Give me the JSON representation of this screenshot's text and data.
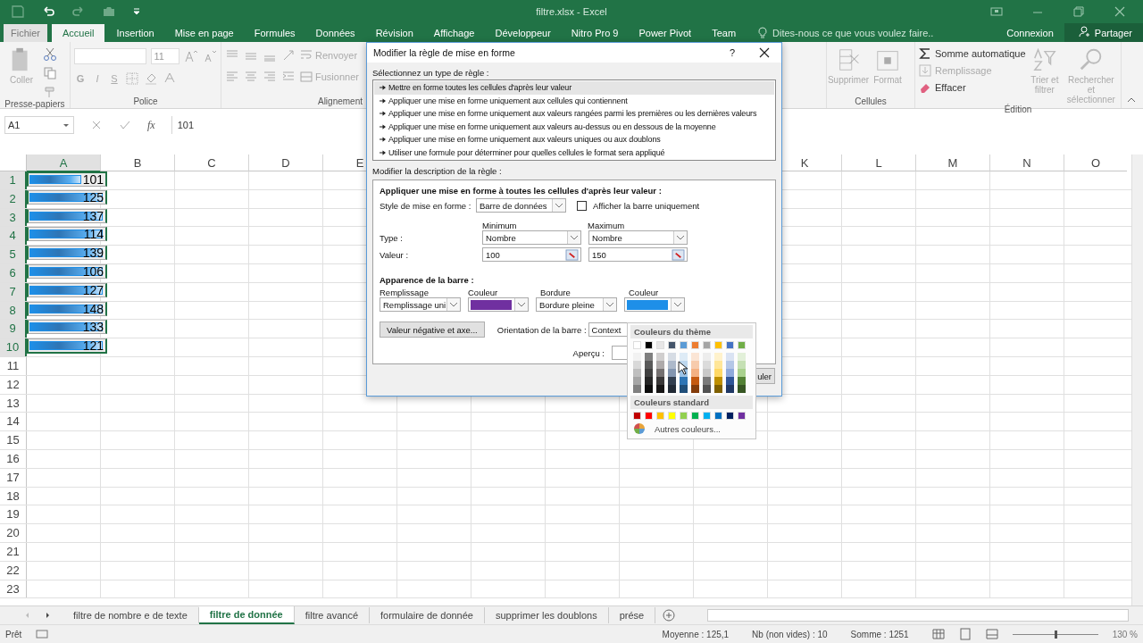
{
  "title_bar": {
    "title": "filtre.xlsx - Excel"
  },
  "ribbon_tabs": [
    {
      "label": "Fichier",
      "selected": false,
      "kind": "file"
    },
    {
      "label": "Accueil",
      "selected": true,
      "kind": "tab"
    },
    {
      "label": "Insertion",
      "selected": false,
      "kind": "tab"
    },
    {
      "label": "Mise en page",
      "selected": false,
      "kind": "tab"
    },
    {
      "label": "Formules",
      "selected": false,
      "kind": "tab"
    },
    {
      "label": "Données",
      "selected": false,
      "kind": "tab"
    },
    {
      "label": "Révision",
      "selected": false,
      "kind": "tab"
    },
    {
      "label": "Affichage",
      "selected": false,
      "kind": "tab"
    },
    {
      "label": "Développeur",
      "selected": false,
      "kind": "tab"
    },
    {
      "label": "Nitro Pro 9",
      "selected": false,
      "kind": "tab"
    },
    {
      "label": "Power Pivot",
      "selected": false,
      "kind": "tab"
    },
    {
      "label": "Team",
      "selected": false,
      "kind": "tab"
    }
  ],
  "tell_me": {
    "placeholder": "Dites-nous ce que vous voulez faire.."
  },
  "account": {
    "sign_in": "Connexion",
    "share": "Partager"
  },
  "ribbon": {
    "clipboard": {
      "paste": "Coller",
      "group": "Presse-papiers"
    },
    "font": {
      "size": "11",
      "bold": "G",
      "italic": "I",
      "underline": "S",
      "group": "Police"
    },
    "alignment": {
      "wrap": "Renvoyer",
      "merge": "Fusionner",
      "group": "Alignement"
    },
    "cells": {
      "delete": "Supprimer",
      "format": "Format",
      "group": "Cellules"
    },
    "editing": {
      "autosum": "Somme automatique",
      "fill": "Remplissage",
      "clear": "Effacer",
      "sort_filter": "Trier et filtrer",
      "find_select": "Rechercher et sélectionner",
      "group": "Édition"
    }
  },
  "formula_bar": {
    "name_box": "A1",
    "function_label": "fx",
    "formula": "101"
  },
  "sheet": {
    "columns_left": [
      "A",
      "B",
      "C",
      "D",
      "E"
    ],
    "columns_right": [
      "K",
      "L",
      "M",
      "N",
      "O"
    ],
    "row_numbers": [
      "1",
      "2",
      "3",
      "4",
      "5",
      "6",
      "7",
      "8",
      "9",
      "10",
      "11",
      "12",
      "13",
      "14",
      "15",
      "16",
      "17",
      "18",
      "19",
      "20",
      "21",
      "22",
      "23"
    ],
    "cells": [
      {
        "value": "101",
        "level": 0.67,
        "selected": true
      },
      {
        "value": "125",
        "level": 0.95,
        "selected": true
      },
      {
        "value": "137",
        "level": 0.95,
        "selected": true
      },
      {
        "value": "114",
        "level": 0.95,
        "selected": true
      },
      {
        "value": "139",
        "level": 0.95,
        "selected": true
      },
      {
        "value": "106",
        "level": 0.95,
        "selected": true
      },
      {
        "value": "127",
        "level": 0.95,
        "selected": true
      },
      {
        "value": "148",
        "level": 0.95,
        "selected": true
      },
      {
        "value": "133",
        "level": 0.95,
        "selected": true
      },
      {
        "value": "121",
        "level": 0.95,
        "selected": true
      }
    ]
  },
  "dialog": {
    "title": "Modifier la règle de mise en forme",
    "help": "?",
    "rule_type_label": "Sélectionnez un type de règle :",
    "rule_types": [
      {
        "label": "Mettre en forme toutes les cellules d'après leur valeur",
        "selected": true
      },
      {
        "label": "Appliquer une mise en forme uniquement aux cellules qui contiennent",
        "selected": false
      },
      {
        "label": "Appliquer une mise en forme uniquement aux valeurs rangées parmi les premières ou les dernières valeurs",
        "selected": false
      },
      {
        "label": "Appliquer une mise en forme uniquement aux valeurs au-dessus ou en dessous de la moyenne",
        "selected": false
      },
      {
        "label": "Appliquer une mise en forme uniquement aux valeurs uniques ou aux doublons",
        "selected": false
      },
      {
        "label": "Utiliser une formule pour déterminer pour quelles cellules le format sera appliqué",
        "selected": false
      }
    ],
    "description_label": "Modifier la description de la règle :",
    "description_heading": "Appliquer une mise en forme à toutes les cellules d'après leur valeur :",
    "style_label": "Style de mise en forme :",
    "style_value": "Barre de données",
    "bar_only": {
      "label": "Afficher la barre uniquement",
      "checked": false
    },
    "minimum_heading": "Minimum",
    "maximum_heading": "Maximum",
    "type_label": "Type :",
    "min_type": "Nombre",
    "max_type": "Nombre",
    "value_label": "Valeur :",
    "min_value": "100",
    "max_value": "150",
    "appearance_heading": "Apparence de la barre :",
    "fill_label": "Remplissage",
    "fill_value": "Remplissage uni",
    "fill_color_label": "Couleur",
    "fill_color": {
      "color": "#7030a0"
    },
    "border_label": "Bordure",
    "border_value": "Bordure pleine",
    "border_color_label": "Couleur",
    "border_color": {
      "color": "#1e8fe8"
    },
    "negative_button": "Valeur négative et axe...",
    "orientation_label": "Orientation de la barre :",
    "orientation_value": "Context",
    "preview_label": "Aperçu :",
    "cancel_button": "uler"
  },
  "color_menu": {
    "theme_heading": "Couleurs du thème",
    "theme_columns": [
      {
        "color": "#ffffff",
        "shades": [
          {
            "color": "#f2f2f2"
          },
          {
            "color": "#d9d9d9"
          },
          {
            "color": "#bfbfbf"
          },
          {
            "color": "#a6a6a6"
          },
          {
            "color": "#808080"
          }
        ]
      },
      {
        "color": "#000000",
        "shades": [
          {
            "color": "#7f7f7f"
          },
          {
            "color": "#595959"
          },
          {
            "color": "#404040"
          },
          {
            "color": "#262626"
          },
          {
            "color": "#0d0d0d"
          }
        ]
      },
      {
        "color": "#e7e6e6",
        "shades": [
          {
            "color": "#d0cece"
          },
          {
            "color": "#aeaaaa"
          },
          {
            "color": "#757171"
          },
          {
            "color": "#3a3838"
          },
          {
            "color": "#171616"
          }
        ]
      },
      {
        "color": "#44546a",
        "shades": [
          {
            "color": "#d6dce4"
          },
          {
            "color": "#adb9ca"
          },
          {
            "color": "#8496b0"
          },
          {
            "color": "#333f4f"
          },
          {
            "color": "#222a35"
          }
        ]
      },
      {
        "color": "#5b9bd5",
        "shades": [
          {
            "color": "#deebf6"
          },
          {
            "color": "#bdd7ee"
          },
          {
            "color": "#9dc3e6"
          },
          {
            "color": "#2e75b5"
          },
          {
            "color": "#1f4e79"
          }
        ]
      },
      {
        "color": "#ed7d31",
        "shades": [
          {
            "color": "#fbe5d5"
          },
          {
            "color": "#f7cbac"
          },
          {
            "color": "#f4b183"
          },
          {
            "color": "#c55a11"
          },
          {
            "color": "#843c0b"
          }
        ]
      },
      {
        "color": "#a5a5a5",
        "shades": [
          {
            "color": "#ededed"
          },
          {
            "color": "#dbdbdb"
          },
          {
            "color": "#c9c9c9"
          },
          {
            "color": "#7b7b7b"
          },
          {
            "color": "#525252"
          }
        ]
      },
      {
        "color": "#ffc000",
        "shades": [
          {
            "color": "#fff2cc"
          },
          {
            "color": "#ffe699"
          },
          {
            "color": "#ffd966"
          },
          {
            "color": "#bf9000"
          },
          {
            "color": "#7f6000"
          }
        ]
      },
      {
        "color": "#4472c4",
        "shades": [
          {
            "color": "#dae3f3"
          },
          {
            "color": "#b4c7e7"
          },
          {
            "color": "#8faadc"
          },
          {
            "color": "#2f5597"
          },
          {
            "color": "#203864"
          }
        ]
      },
      {
        "color": "#70ad47",
        "shades": [
          {
            "color": "#e2f0d9"
          },
          {
            "color": "#c5e0b4"
          },
          {
            "color": "#a9d18e"
          },
          {
            "color": "#538135"
          },
          {
            "color": "#375623"
          }
        ]
      }
    ],
    "standard_heading": "Couleurs standard",
    "standard_colors": [
      {
        "color": "#c00000"
      },
      {
        "color": "#ff0000"
      },
      {
        "color": "#ffc000"
      },
      {
        "color": "#ffff00"
      },
      {
        "color": "#92d050"
      },
      {
        "color": "#00b050"
      },
      {
        "color": "#00b0f0"
      },
      {
        "color": "#0070c0"
      },
      {
        "color": "#002060"
      },
      {
        "color": "#7030a0"
      }
    ],
    "more_colors": "Autres couleurs..."
  },
  "sheet_tabs": [
    {
      "label": "filtre de nombre e de texte",
      "selected": false
    },
    {
      "label": "filtre de donnée",
      "selected": true
    },
    {
      "label": "filtre avancé",
      "selected": false
    },
    {
      "label": "formulaire de donnée",
      "selected": false
    },
    {
      "label": "supprimer les doublons",
      "selected": false
    },
    {
      "label": "prése",
      "selected": false
    }
  ],
  "status_bar": {
    "state": "Prêt",
    "average": "Moyenne : 125,1",
    "count": "Nb (non vides) : 10",
    "sum": "Somme : 1251",
    "zoom_slider": {
      "level": 0.5
    },
    "zoom": "130 %"
  }
}
